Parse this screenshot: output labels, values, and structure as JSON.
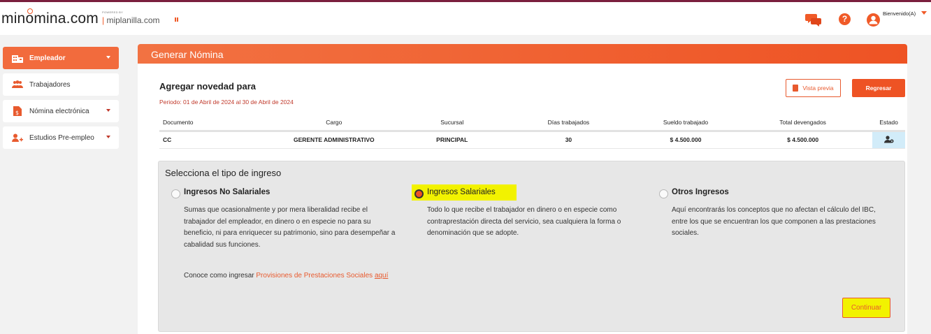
{
  "header": {
    "logo_text": "minomina.com",
    "logo_part_a": "min",
    "logo_part_b": "o",
    "logo_part_c": "mina.com",
    "powered_by": "POWERED BY",
    "partner": "miplanilla.com",
    "partner_bar": "|",
    "welcome": "Bienvenido(A)",
    "help_glyph": "?"
  },
  "sidebar": {
    "items": [
      {
        "label": "Empleador",
        "icon": "building-icon",
        "active": true
      },
      {
        "label": "Trabajadores",
        "icon": "users-icon",
        "active": false
      },
      {
        "label": "Nómina electrónica",
        "icon": "document-dollar-icon",
        "active": false
      },
      {
        "label": "Estudios Pre-empleo",
        "icon": "user-plus-icon",
        "active": false
      }
    ]
  },
  "panel": {
    "title": "Generar Nómina",
    "section_title": "Agregar novedad para",
    "periodo": "Periodo: 01 de Abril de 2024 al 30 de Abril de 2024",
    "vista_previa": "Vista previa",
    "regresar": "Regresar"
  },
  "table": {
    "headers": [
      "Documento",
      "Cargo",
      "Sucursal",
      "Días trabajados",
      "Sueldo trabajado",
      "Total devengados",
      "Estado"
    ],
    "rows": [
      [
        "CC",
        "GERENTE ADMINISTRATIVO",
        "PRINCIPAL",
        "30",
        "$ 4.500.000",
        "$ 4.500.000"
      ]
    ]
  },
  "tipo_ingreso": {
    "title": "Selecciona el tipo de ingreso",
    "options": [
      {
        "label": "Ingresos No Salariales",
        "selected": false,
        "desc_lines": [
          "Sumas que ocasionalmente y por mera liberalidad recibe el",
          "trabajador del empleador, en dinero o en especie no para su",
          "beneficio, ni para enriquecer su patrimonio, sino para desempeñar a",
          "cabalidad sus funciones."
        ]
      },
      {
        "label": "Ingresos Salariales",
        "selected": true,
        "desc_lines": [
          "Todo lo que recibe el trabajador en dinero o en especie como",
          "contraprestación directa del servicio, sea cualquiera la forma o",
          "denominación que se adopte."
        ]
      },
      {
        "label": "Otros Ingresos",
        "selected": false,
        "desc_lines": [
          "Aquí encontrarás los conceptos que no afectan el cálculo del IBC,",
          "entre los que se encuentran los que componen a las prestaciones",
          "sociales."
        ]
      }
    ],
    "conoce_prefix": "Conoce como ingresar ",
    "conoce_link": "Provisiones de Prestaciones Sociales",
    "conoce_aqui": "aquí",
    "continuar": "Continuar"
  },
  "colors": {
    "accent": "#ee5324",
    "brand_line": "#7a1f3d",
    "highlight": "#f2f200",
    "estado_bg": "#d2ecf9"
  }
}
